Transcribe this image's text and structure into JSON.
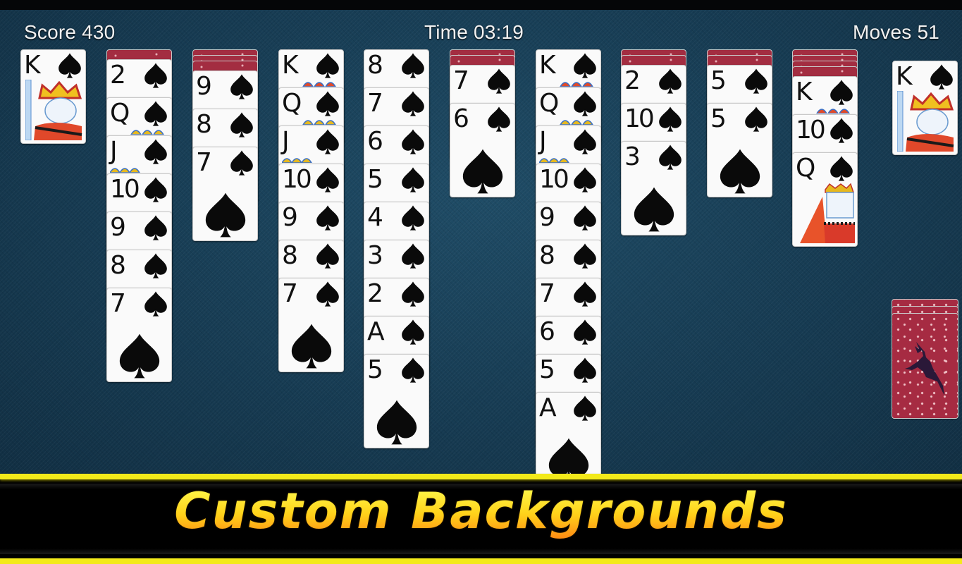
{
  "hud": {
    "score_label": "Score 430",
    "time_label": "Time 03:19",
    "moves_label": "Moves 51"
  },
  "game": {
    "score": 430,
    "time": "03:19",
    "moves": 51,
    "suit": "spades",
    "suit_glyph": "♠",
    "colors": {
      "felt": "#163a51",
      "card_back": "#a32d41",
      "banner_yellow": "#f3ea1a",
      "banner_text_top": "#fff84a",
      "banner_text_bottom": "#ff8f14"
    }
  },
  "completed_foundation_left": {
    "rank": "K",
    "suit": "spades"
  },
  "completed_foundation_right": {
    "rank": "K",
    "suit": "spades"
  },
  "tableau": [
    {
      "face_down": 1,
      "face_up": [
        "2",
        "Q",
        "J",
        "10",
        "9",
        "8",
        "7"
      ]
    },
    {
      "face_down": 3,
      "face_up": [
        "9",
        "8",
        "7"
      ]
    },
    {
      "face_down": 0,
      "face_up": [
        "K",
        "Q",
        "J",
        "10",
        "9",
        "8",
        "7"
      ]
    },
    {
      "face_down": 0,
      "face_up": [
        "8",
        "7",
        "6",
        "5",
        "4",
        "3",
        "2",
        "A",
        "5"
      ]
    },
    {
      "face_down": 2,
      "face_up": [
        "7",
        "6"
      ]
    },
    {
      "face_down": 0,
      "face_up": [
        "K",
        "Q",
        "J",
        "10",
        "9",
        "8",
        "7",
        "6",
        "5",
        "A"
      ]
    },
    {
      "face_down": 2,
      "face_up": [
        "2",
        "10",
        "3"
      ]
    },
    {
      "face_down": 2,
      "face_up": [
        "5",
        "5"
      ]
    },
    {
      "face_down": 4,
      "face_up": [
        "K",
        "10",
        "Q"
      ]
    }
  ],
  "stock": {
    "remaining_deals": 3,
    "back_design": "reindeer-snow"
  },
  "banner": {
    "text": "Custom Backgrounds"
  }
}
